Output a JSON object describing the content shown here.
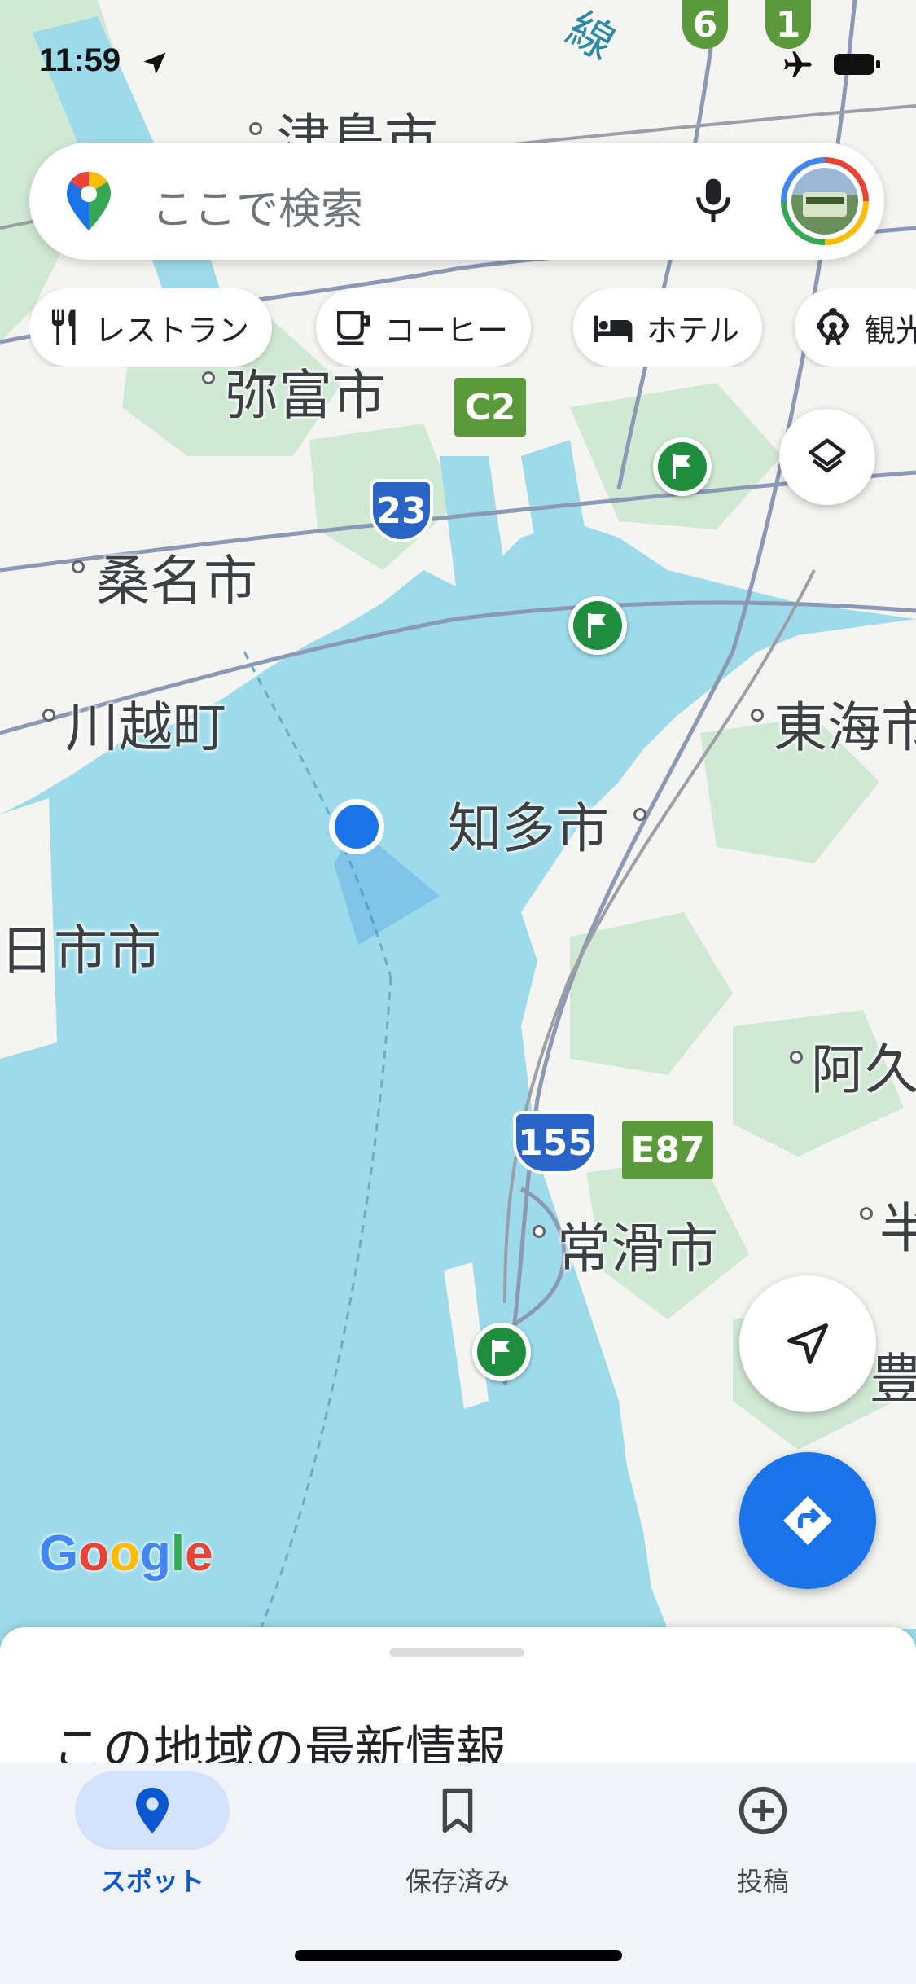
{
  "status_bar": {
    "time": "11:59",
    "icons": [
      "location-arrow-icon",
      "airplane-mode-icon",
      "battery-icon"
    ]
  },
  "search": {
    "placeholder": "ここで検索",
    "logo_icon": "google-maps-pin-icon",
    "mic_icon": "microphone-icon",
    "avatar_icon": "profile-avatar"
  },
  "chips": [
    {
      "label": "レストラン",
      "icon": "restaurant-icon"
    },
    {
      "label": "コーヒー",
      "icon": "coffee-icon"
    },
    {
      "label": "ホテル",
      "icon": "hotel-bed-icon"
    },
    {
      "label": "観光",
      "icon": "ferris-wheel-icon"
    }
  ],
  "map": {
    "labels": {
      "tsushima": "津島市",
      "yatomi": "弥富市",
      "kuwana": "桑名市",
      "kawagoe": "川越町",
      "tokai": "東海市",
      "chita": "知多市",
      "yokkaichi": "日市市",
      "agui": "阿久",
      "tokoname": "常滑市",
      "toyo": "豊",
      "han": "半",
      "rail": "線"
    },
    "shields": {
      "c2": "C2",
      "r23": "23",
      "r155": "155",
      "e87": "E87",
      "n6": "6",
      "n1": "1"
    },
    "colors": {
      "water": "#9ddbea",
      "land": "#f4f4f2",
      "park": "#cfe9d2",
      "road": "#8b99b5",
      "my_location": "#1a73e8"
    }
  },
  "layers_button_icon": "layers-icon",
  "recenter_button_icon": "navigation-arrow-icon",
  "directions_button_icon": "directions-icon",
  "google_logo": {
    "letters": [
      "G",
      "o",
      "o",
      "g",
      "l",
      "e"
    ],
    "colors": [
      "#4285f4",
      "#ea4335",
      "#fbbc05",
      "#4285f4",
      "#34a853",
      "#ea4335"
    ]
  },
  "bottom_sheet": {
    "title": "この地域の最新情報"
  },
  "nav": {
    "items": [
      {
        "label": "スポット",
        "icon": "explore-pin-icon",
        "active": true
      },
      {
        "label": "保存済み",
        "icon": "bookmark-icon",
        "active": false
      },
      {
        "label": "投稿",
        "icon": "add-circle-icon",
        "active": false
      }
    ]
  }
}
